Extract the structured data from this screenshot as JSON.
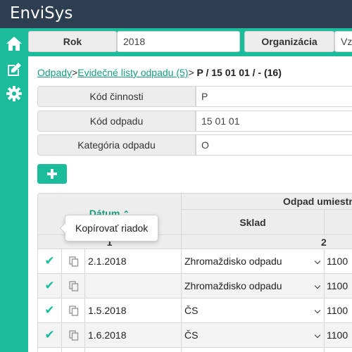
{
  "app": {
    "title": "EnviSys"
  },
  "sidebar": {
    "items": [
      {
        "icon": "home-icon"
      },
      {
        "icon": "edit-icon"
      },
      {
        "icon": "gear-icon"
      }
    ]
  },
  "filters": {
    "year_label": "Rok",
    "year_value": "2018",
    "org_label": "Organizácia",
    "org_value": "Vzo"
  },
  "breadcrumb": {
    "link1": "Odpady",
    "sep1": ">",
    "link2": "Evidečné listy odpadu (5)",
    "sep2": ">",
    "current": "P / 15 01 01 / - (16)"
  },
  "info": [
    {
      "label": "Kód činnosti",
      "value": "P"
    },
    {
      "label": "Kód odpadu",
      "value": "15 01 01"
    },
    {
      "label": "Kategória odpadu",
      "value": "O"
    }
  ],
  "table": {
    "col_date": "Dátum",
    "sort_indicator": "⌃",
    "group_header": "Odpad umiestne",
    "col_sklad": "Sklad",
    "col_num_1": "1",
    "col_num_2": "2",
    "rows": [
      {
        "date": "2.1.2018",
        "sklad": "Zhromaždisko odpadu",
        "amount": "1100"
      },
      {
        "date": "",
        "sklad": "Zhromaždisko odpadu",
        "amount": "1100"
      },
      {
        "date": "1.5.2018",
        "sklad": "ČS",
        "amount": "1100"
      },
      {
        "date": "1.6.2018",
        "sklad": "ČS",
        "amount": "1100"
      }
    ]
  },
  "tooltip": {
    "text": "Kopírovať riadok"
  },
  "colors": {
    "accent": "#1abc9c",
    "topbar": "#2c3e50",
    "link": "#1a9c7f"
  }
}
